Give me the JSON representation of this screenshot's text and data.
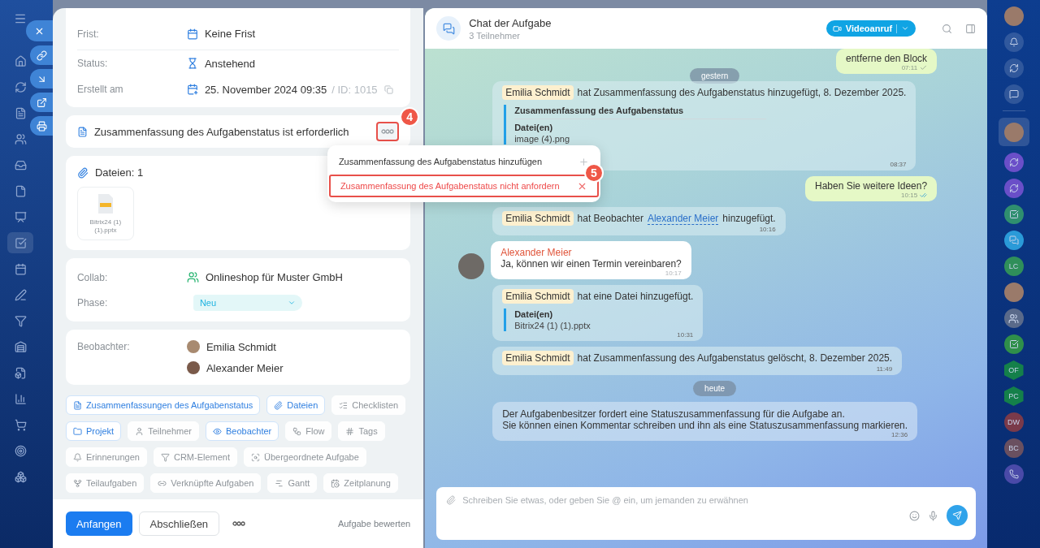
{
  "side_actions": [
    {
      "kind": "close"
    },
    {
      "kind": "link"
    },
    {
      "kind": "download"
    },
    {
      "kind": "open"
    },
    {
      "kind": "print"
    }
  ],
  "task": {
    "fields": [
      {
        "label": "Frist:",
        "value": "Keine Frist"
      },
      {
        "label": "Status:",
        "value": "Anstehend"
      },
      {
        "label": "Erstellt am",
        "value": "25. November 2024 09:35",
        "extra": "/ ID: 1015"
      }
    ],
    "summary_required": {
      "text": "Zusammenfassung des Aufgabenstatus ist erforderlich"
    },
    "menu": {
      "items": [
        {
          "label": "Zusammenfassung des Aufgabenstatus hinzufügen",
          "kind": "add",
          "selected": false
        },
        {
          "label": "Zusammenfassung des Aufgabenstatus nicht anfordern",
          "kind": "remove",
          "selected": true
        }
      ]
    },
    "annotations": [
      {
        "label": "4"
      },
      {
        "label": "5"
      }
    ],
    "files": {
      "title": "Dateien: 1",
      "items": [
        {
          "name": "Bitrix24 (1) (1).pptx"
        }
      ]
    },
    "collab": {
      "label": "Collab:",
      "value": "Onlineshop für Muster GmbH"
    },
    "phase": {
      "label": "Phase:",
      "value": "Neu"
    },
    "observers": {
      "label": "Beobachter:",
      "people": [
        "Emilia Schmidt",
        "Alexander Meier"
      ]
    },
    "chips": [
      [
        {
          "label": "Zusammenfassungen des Aufgabenstatus",
          "active": true
        },
        {
          "label": "Dateien",
          "active": true
        },
        {
          "label": "Checklisten",
          "active": false
        }
      ],
      [
        {
          "label": "Projekt",
          "active": true
        },
        {
          "label": "Teilnehmer",
          "active": false
        },
        {
          "label": "Beobachter",
          "active": true
        },
        {
          "label": "Flow",
          "active": false
        },
        {
          "label": "Tags",
          "active": false
        }
      ],
      [
        {
          "label": "Erinnerungen",
          "active": false
        },
        {
          "label": "CRM-Element",
          "active": false
        },
        {
          "label": "Übergeordnete Aufgabe",
          "active": false
        }
      ],
      [
        {
          "label": "Teilaufgaben",
          "active": false
        },
        {
          "label": "Verknüpfte Aufgaben",
          "active": false
        },
        {
          "label": "Gantt",
          "active": false
        },
        {
          "label": "Zeitplanung",
          "active": false
        }
      ]
    ],
    "footer": {
      "primary": "Anfangen",
      "secondary": "Abschließen",
      "rate": "Aufgabe bewerten"
    }
  },
  "chat": {
    "title": "Chat der Aufgabe",
    "subtitle": "3 Teilnehmer",
    "call_button": "Videoanruf",
    "messages": [
      {
        "kind": "outgoing",
        "text": "entferne den Block",
        "time": "07:11",
        "read": false
      },
      {
        "kind": "date",
        "text": "gestern"
      },
      {
        "kind": "system",
        "author": "Emilia Schmidt",
        "text": "hat Zusammenfassung des Aufgabenstatus hinzugefügt, 8. Dezember 2025.",
        "quote": {
          "title": "Zusammenfassung des Aufgabenstatus",
          "label": "Datei(en)",
          "value": "image (4).png"
        },
        "time": "08:37"
      },
      {
        "kind": "outgoing",
        "text": "Haben Sie weitere Ideen?",
        "time": "10:15",
        "read": true
      },
      {
        "kind": "system",
        "author": "Emilia Schmidt",
        "text": "hat Beobachter",
        "link": "Alexander Meier",
        "after": "hinzugefügt.",
        "time": "10:16"
      },
      {
        "kind": "incoming",
        "author": "Alexander Meier",
        "text": "Ja, können wir einen Termin vereinbaren?",
        "time": "10:17"
      },
      {
        "kind": "system",
        "author": "Emilia Schmidt",
        "text": "hat eine Datei hinzugefügt.",
        "quote": {
          "label": "Datei(en)",
          "value": "Bitrix24 (1) (1).pptx"
        },
        "time": "10:31"
      },
      {
        "kind": "system",
        "author": "Emilia Schmidt",
        "text": "hat Zusammenfassung des Aufgabenstatus gelöscht, 8. Dezember 2025.",
        "time": "11:49"
      },
      {
        "kind": "date",
        "text": "heute"
      },
      {
        "kind": "notice",
        "lines": [
          "Der Aufgabenbesitzer fordert eine Statuszusammenfassung für die Aufgabe an.",
          "Sie können einen Kommentar schreiben und ihn als eine Statuszusammenfassung markieren."
        ],
        "time": "12:36"
      }
    ],
    "input": {
      "placeholder": "Schreiben Sie etwas, oder geben Sie @ ein, um jemanden zu erwähnen"
    }
  },
  "right_bar": [
    {
      "kind": "photo",
      "selected": false
    },
    {
      "kind": "bell"
    },
    {
      "kind": "copilot"
    },
    {
      "kind": "chats"
    },
    {
      "kind": "divider"
    },
    {
      "kind": "photo",
      "selected": true
    },
    {
      "kind": "copilot",
      "color": "#6a4fc8"
    },
    {
      "kind": "copilot",
      "color": "#6a4fc8"
    },
    {
      "kind": "task",
      "color": "#2f8f6f"
    },
    {
      "kind": "chat",
      "color": "#2a9ad8"
    },
    {
      "kind": "initials",
      "text": "LC",
      "color": "#2f8f5a"
    },
    {
      "kind": "photo",
      "selected": false
    },
    {
      "kind": "group"
    },
    {
      "kind": "task",
      "color": "#2f8f4a"
    },
    {
      "kind": "hex",
      "text": "OF",
      "color": "#14804a"
    },
    {
      "kind": "hex",
      "text": "PC",
      "color": "#14804a"
    },
    {
      "kind": "initials",
      "text": "DW",
      "color": "#7a3a4a"
    },
    {
      "kind": "initials",
      "text": "BC",
      "color": "#6a5060"
    },
    {
      "kind": "phone",
      "color": "#4a4aa8"
    }
  ]
}
